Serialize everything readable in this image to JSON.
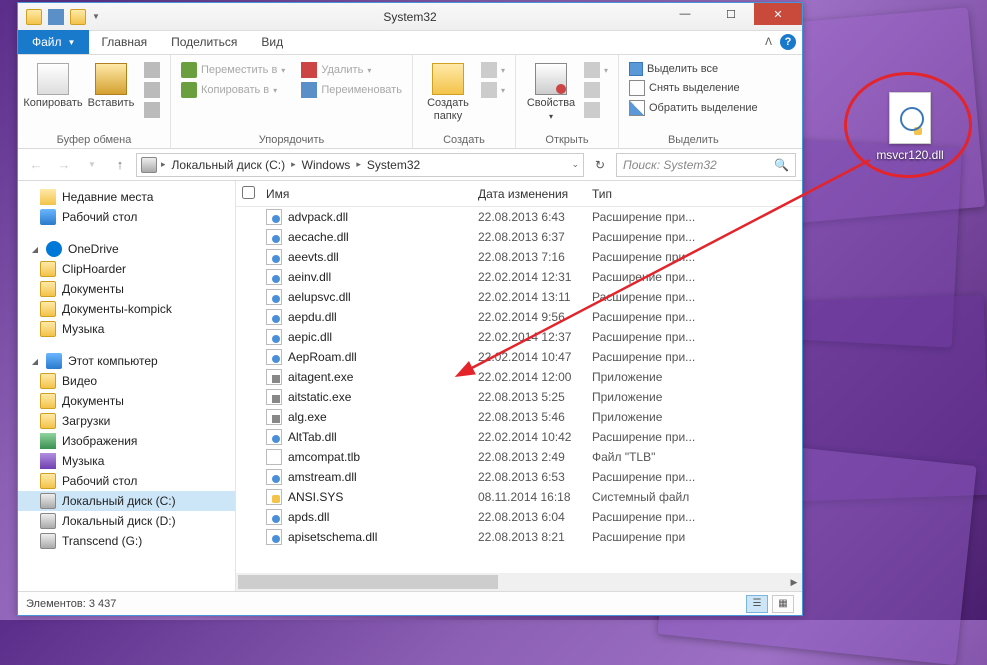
{
  "window": {
    "title": "System32",
    "tabs": {
      "file": "Файл",
      "home": "Главная",
      "share": "Поделиться",
      "view": "Вид"
    }
  },
  "ribbon": {
    "clipboard": {
      "copy": "Копировать",
      "paste": "Вставить",
      "label": "Буфер обмена"
    },
    "organize": {
      "move_to": "Переместить в",
      "copy_to": "Копировать в",
      "delete": "Удалить",
      "rename": "Переименовать",
      "label": "Упорядочить"
    },
    "new": {
      "new_folder": "Создать папку",
      "label": "Создать"
    },
    "open": {
      "properties": "Свойства",
      "label": "Открыть"
    },
    "select": {
      "select_all": "Выделить все",
      "select_none": "Снять выделение",
      "invert": "Обратить выделение",
      "label": "Выделить"
    }
  },
  "breadcrumb": {
    "items": [
      "Локальный диск (C:)",
      "Windows",
      "System32"
    ]
  },
  "search": {
    "placeholder": "Поиск: System32"
  },
  "nav": {
    "recent": "Недавние места",
    "desktop": "Рабочий стол",
    "onedrive": "OneDrive",
    "cliphoarder": "ClipHoarder",
    "documents": "Документы",
    "documents_kompick": "Документы-kompick",
    "music": "Музыка",
    "this_pc": "Этот компьютер",
    "video": "Видео",
    "documents2": "Документы",
    "downloads": "Загрузки",
    "pictures": "Изображения",
    "music2": "Музыка",
    "desktop2": "Рабочий стол",
    "drive_c": "Локальный диск (C:)",
    "drive_d": "Локальный диск (D:)",
    "drive_g": "Transcend (G:)"
  },
  "columns": {
    "name": "Имя",
    "date": "Дата изменения",
    "type": "Тип"
  },
  "files": [
    {
      "icon": "dll",
      "name": "advpack.dll",
      "date": "22.08.2013 6:43",
      "type": "Расширение при..."
    },
    {
      "icon": "dll",
      "name": "aecache.dll",
      "date": "22.08.2013 6:37",
      "type": "Расширение при..."
    },
    {
      "icon": "dll",
      "name": "aeevts.dll",
      "date": "22.08.2013 7:16",
      "type": "Расширение при..."
    },
    {
      "icon": "dll",
      "name": "aeinv.dll",
      "date": "22.02.2014 12:31",
      "type": "Расширение при..."
    },
    {
      "icon": "dll",
      "name": "aelupsvc.dll",
      "date": "22.02.2014 13:11",
      "type": "Расширение при..."
    },
    {
      "icon": "dll",
      "name": "aepdu.dll",
      "date": "22.02.2014 9:56",
      "type": "Расширение при..."
    },
    {
      "icon": "dll",
      "name": "aepic.dll",
      "date": "22.02.2014 12:37",
      "type": "Расширение при..."
    },
    {
      "icon": "dll",
      "name": "AepRoam.dll",
      "date": "22.02.2014 10:47",
      "type": "Расширение при..."
    },
    {
      "icon": "exe",
      "name": "aitagent.exe",
      "date": "22.02.2014 12:00",
      "type": "Приложение"
    },
    {
      "icon": "exe",
      "name": "aitstatic.exe",
      "date": "22.08.2013 5:25",
      "type": "Приложение"
    },
    {
      "icon": "exe",
      "name": "alg.exe",
      "date": "22.08.2013 5:46",
      "type": "Приложение"
    },
    {
      "icon": "dll",
      "name": "AltTab.dll",
      "date": "22.02.2014 10:42",
      "type": "Расширение при..."
    },
    {
      "icon": "plain",
      "name": "amcompat.tlb",
      "date": "22.08.2013 2:49",
      "type": "Файл \"TLB\""
    },
    {
      "icon": "dll",
      "name": "amstream.dll",
      "date": "22.08.2013 6:53",
      "type": "Расширение при..."
    },
    {
      "icon": "sys",
      "name": "ANSI.SYS",
      "date": "08.11.2014 16:18",
      "type": "Системный файл"
    },
    {
      "icon": "dll",
      "name": "apds.dll",
      "date": "22.08.2013 6:04",
      "type": "Расширение при..."
    },
    {
      "icon": "dll",
      "name": "apisetschema.dll",
      "date": "22.08.2013 8:21",
      "type": "Расширение при"
    }
  ],
  "status": {
    "elements_label": "Элементов:",
    "count": "3 437"
  },
  "desktop_file": {
    "name": "msvcr120.dll"
  }
}
